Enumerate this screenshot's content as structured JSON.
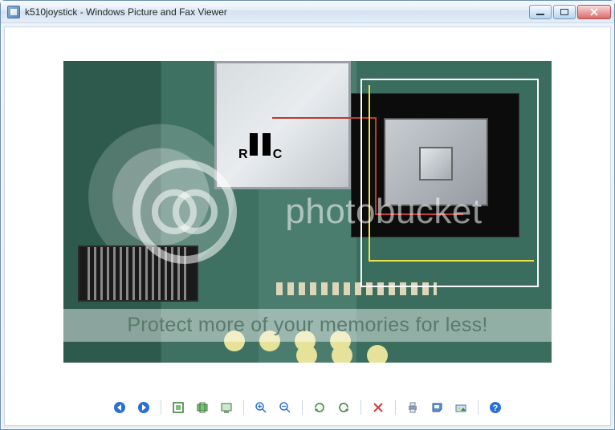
{
  "window": {
    "title": "k510joystick - Windows Picture and Fax Viewer"
  },
  "watermark": {
    "brand": "photobucket",
    "tagline": "Protect more of your memories for less!"
  },
  "image_overlay": {
    "r_label": "R",
    "c_label": "C"
  },
  "toolbar": {
    "previous": "Previous Image",
    "next": "Next Image",
    "best_fit": "Best Fit",
    "actual_size": "Actual Size",
    "slideshow": "Start Slide Show",
    "zoom_in": "Zoom In",
    "zoom_out": "Zoom Out",
    "rotate_cw": "Rotate Clockwise",
    "rotate_ccw": "Rotate Counterclockwise",
    "delete": "Delete",
    "print": "Print",
    "copy_to": "Copy To",
    "edit": "Open for Editing",
    "help": "Help"
  },
  "colors": {
    "accent": "#3a6d5e",
    "titlebar": "#e2ecf7",
    "close": "#d86a6a"
  }
}
